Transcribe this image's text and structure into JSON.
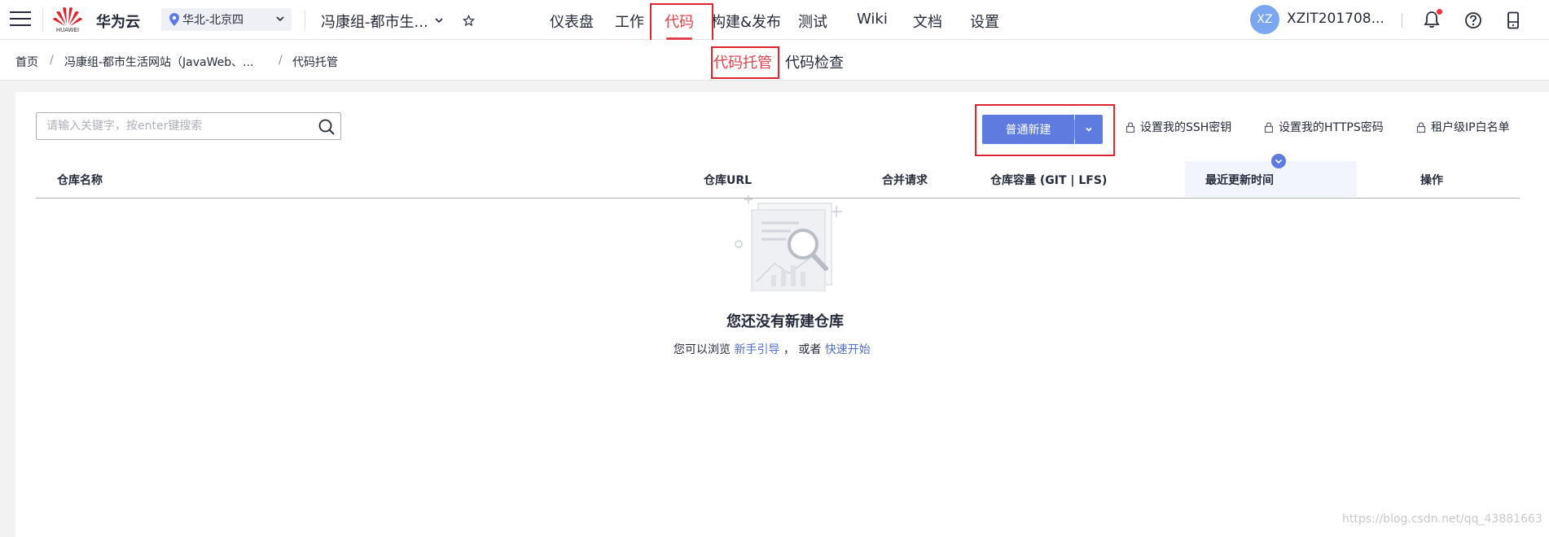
{
  "header": {
    "logo_caption": "HUAWEI",
    "brand": "华为云",
    "region": "华北-北京四",
    "project": "冯康组-都市生...",
    "nav": [
      "仪表盘",
      "工作",
      "代码",
      "构建&发布",
      "测试",
      "Wiki",
      "文档",
      "设置"
    ],
    "active_nav": "代码",
    "avatar_initials": "XZ",
    "username": "XZIT201708..."
  },
  "breadcrumb": [
    "首页",
    "冯康组-都市生活网站（JavaWeb、...",
    "代码托管"
  ],
  "subtabs": [
    "代码托管",
    "代码检查"
  ],
  "active_subtab": "代码托管",
  "toolbar": {
    "search_placeholder": "请输入关键字，按enter键搜索",
    "new_button": "普通新建",
    "ssh_link": "设置我的SSH密钥",
    "https_link": "设置我的HTTPS密码",
    "ip_link": "租户级IP白名单"
  },
  "table": {
    "columns": [
      "仓库名称",
      "仓库URL",
      "合并请求",
      "仓库容量 (GIT | LFS)",
      "最近更新时间",
      "操作"
    ]
  },
  "empty": {
    "title": "您还没有新建仓库",
    "prefix": "您可以浏览",
    "link1": "新手引导",
    "middle": "， 或者",
    "link2": "快速开始"
  },
  "watermark": "https://blog.csdn.net/qq_43881663",
  "colors": {
    "accent": "#5e7ce0",
    "active_red": "#e0434b",
    "link": "#526ecc",
    "annotation_box": "#e0242f"
  }
}
